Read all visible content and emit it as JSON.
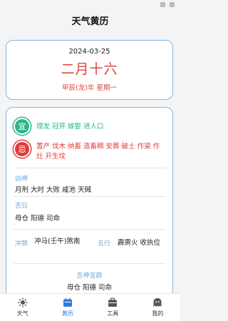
{
  "header": {
    "title": "天气黄历"
  },
  "date_card": {
    "gregorian": "2024-03-25",
    "lunar": "二月十六",
    "ganzhi": "甲辰(龙)年",
    "weekday": "星期一"
  },
  "almanac": {
    "yi_badge": "宜",
    "yi_text": "理发 冠笄 嫁娶 进人口",
    "ji_badge": "忌",
    "ji_text": "置产 伐木 纳畜 造畜稠 安葬 破土 作梁 作灶 开生坟",
    "xiongshen_label": "凶神",
    "xiongshen_text": "月刑 大时 大败 咸池 天贼",
    "jiri_label": "吉日",
    "jiri_text": "母仓 阳德 司命",
    "chongsha_label": "冲煞",
    "chongsha_text": "冲马(壬午)煞南",
    "wuxing_label": "五行",
    "wuxing_text": "霹雳火 收执位",
    "jishen_label": "吉神宜趋",
    "jishen_text": "母仓 阳德 司命"
  },
  "tabs": [
    {
      "label": "天气",
      "icon": "sun-icon"
    },
    {
      "label": "黄历",
      "icon": "calendar-icon",
      "active": true
    },
    {
      "label": "工具",
      "icon": "toolbox-icon"
    },
    {
      "label": "我的",
      "icon": "profile-icon"
    }
  ],
  "colors": {
    "accent": "#2d7be5",
    "red": "#e23a3a",
    "green": "#2fb58c",
    "label_blue": "#6fa8dc",
    "border": "#7fb6e8"
  }
}
